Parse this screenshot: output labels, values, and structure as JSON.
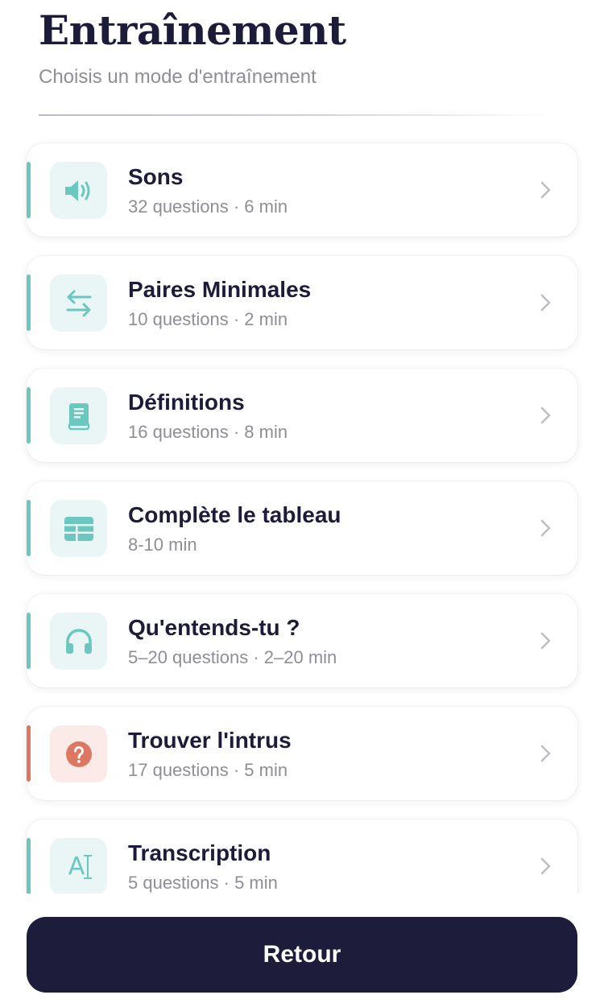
{
  "header": {
    "title": "Entraînement",
    "subtitle": "Choisis un mode d'entraînement"
  },
  "colors": {
    "accent": "#6cc7bf",
    "warning": "#dd7761",
    "dark": "#1e1c3b"
  },
  "modes": [
    {
      "title": "Sons",
      "meta": "32 questions · 6 min",
      "icon": "speaker-icon"
    },
    {
      "title": "Paires Minimales",
      "meta": "10 questions · 2 min",
      "icon": "arrows-swap-icon"
    },
    {
      "title": "Définitions",
      "meta": "16 questions · 8 min",
      "icon": "book-icon"
    },
    {
      "title": "Complète le tableau",
      "meta": "8-10 min",
      "icon": "table-icon"
    },
    {
      "title": "Qu'entends-tu ?",
      "meta": "5–20 questions · 2–20 min",
      "icon": "headphones-icon"
    },
    {
      "title": "Trouver l'intrus",
      "meta": "17 questions · 5 min",
      "icon": "question-icon"
    },
    {
      "title": "Transcription",
      "meta": "5 questions · 5 min",
      "icon": "text-cursor-icon",
      "icon_text": "A"
    }
  ],
  "footer": {
    "back_label": "Retour"
  }
}
